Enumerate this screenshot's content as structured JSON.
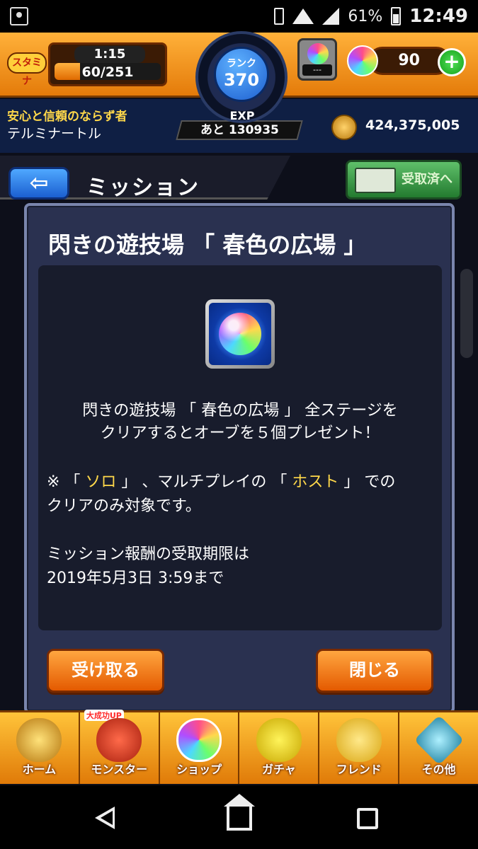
{
  "status_bar": {
    "battery": "61%",
    "time": "12:49"
  },
  "hud": {
    "stamina_label": "スタミナ",
    "stamina_timer": "1:15",
    "stamina_value": "60/251",
    "stamina_fraction": 0.24,
    "rank_label": "ランク",
    "rank_value": "370",
    "orb_slot_text": "---",
    "orb_count": "90",
    "plus_label": "+"
  },
  "player": {
    "title": "安心と信頼のならず者",
    "name": "テルミナートル",
    "exp_label": "EXP",
    "exp_remaining": "あと 130935",
    "coins": "424,375,005"
  },
  "header": {
    "back_label": "⇦",
    "title": "ミッション",
    "received_label": "受取済へ"
  },
  "modal": {
    "title": "閃きの遊技場 「 春色の広場 」",
    "description_line1": "閃きの遊技場 「 春色の広場 」 全ステージを",
    "description_line2": "クリアするとオーブを５個プレゼント！",
    "note_prefix": "※ 「 ",
    "note_solo": "ソロ",
    "note_mid": " 」 、マルチプレイの 「 ",
    "note_host": "ホスト",
    "note_suffix": " 」 での",
    "note_line2": "クリアのみ対象です。",
    "deadline_line1": "ミッション報酬の受取期限は",
    "deadline_line2": "2019年5月3日 3:59まで",
    "receive_button": "受け取る",
    "close_button": "閉じる"
  },
  "bottom_nav": {
    "items": [
      {
        "label": "ホーム"
      },
      {
        "label": "モンスター",
        "badge": "大成功UP"
      },
      {
        "label": "ショップ"
      },
      {
        "label": "ガチャ"
      },
      {
        "label": "フレンド"
      },
      {
        "label": "その他"
      }
    ]
  },
  "colors": {
    "accent_orange": "#e47b0a",
    "highlight_yellow": "#ffd84a",
    "modal_bg": "#2a3150"
  }
}
